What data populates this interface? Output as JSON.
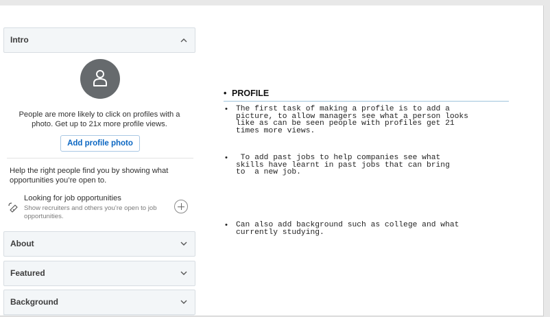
{
  "profile_panel": {
    "intro": {
      "title": "Intro",
      "state": "expanded"
    },
    "intro_text": "People are more likely to click on profiles with a photo. Get up to 21x more profile views.",
    "add_photo_label": "Add profile photo",
    "help_text": "Help the right people find you by showing what opportunities you’re open to.",
    "job": {
      "title": "Looking for job opportunities",
      "subtitle": "Show recruiters and others you’re open to job opportunities."
    },
    "sections": [
      {
        "title": "About",
        "state": "collapsed"
      },
      {
        "title": "Featured",
        "state": "collapsed"
      },
      {
        "title": "Background",
        "state": "collapsed"
      }
    ]
  },
  "notes": {
    "heading": "PROFILE",
    "bullets": [
      "The first task of making a profile is to add a\npicture, to allow managers see what a person looks\nlike as can be seen people with profiles get 21\ntimes more views.",
      " To add past jobs to help companies see what\nskills have learnt in past jobs that can bring\nto  a new job.",
      "Can also add background such as college and what\ncurrently studying."
    ]
  },
  "colors": {
    "accent": "#0a66c2",
    "avatar": "#666a6d",
    "section_bg": "#f3f6f8"
  }
}
